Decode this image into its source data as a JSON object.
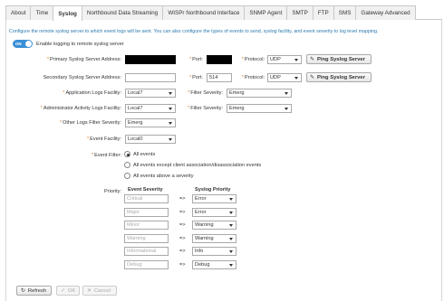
{
  "tabs": [
    "About",
    "Time",
    "Syslog",
    "Northbound Data Streaming",
    "WISPr Northbound Interface",
    "SNMP Agent",
    "SMTP",
    "FTP",
    "SMS",
    "Gateway Advanced"
  ],
  "intro": "Configure the remote syslog server to which event logs will be sent. You can also configure the types of events to send, syslog facility, and event severity to log level mapping.",
  "toggle": {
    "state": "ON",
    "label": "Enable logging to remote syslog server"
  },
  "primary": {
    "label": "Primary Syslog Server Address:",
    "port_label": "Port:",
    "protocol_label": "Protocol:",
    "protocol": "UDP",
    "ping": "Ping Syslog Server"
  },
  "secondary": {
    "label": "Secondary Syslog Server Address:",
    "port_label": "Port:",
    "port": "514",
    "protocol_label": "Protocol:",
    "protocol": "UDP",
    "ping": "Ping Syslog Server"
  },
  "app_logs": {
    "label": "Application Logs Facility:",
    "value": "Local7",
    "filter_label": "Filter Severity:",
    "filter": "Emerg"
  },
  "admin_logs": {
    "label": "Administrator Activity Logs Facility:",
    "value": "Local7",
    "filter_label": "Filter Severity:",
    "filter": "Emerg"
  },
  "other_logs": {
    "label": "Other Logs Filter Severity:",
    "value": "Emerg"
  },
  "event_facility": {
    "label": "Event Facility:",
    "value": "Local0"
  },
  "event_filter": {
    "label": "Event Filter:",
    "options": [
      "All events",
      "All events except client association/disassociation events",
      "All events above a severity"
    ],
    "selected": 0
  },
  "priority": {
    "label": "Priority:",
    "col1": "Event Severity",
    "col2": "Syslog Priority",
    "arrow": "=>",
    "rows": [
      {
        "severity": "Critical",
        "syslog": "Error"
      },
      {
        "severity": "Major",
        "syslog": "Error"
      },
      {
        "severity": "Minor",
        "syslog": "Warning"
      },
      {
        "severity": "Warning",
        "syslog": "Warning"
      },
      {
        "severity": "Informational",
        "syslog": "Info"
      },
      {
        "severity": "Debug",
        "syslog": "Debug"
      }
    ]
  },
  "footer": {
    "refresh": "Refresh",
    "ok": "OK",
    "cancel": "Cancel"
  }
}
